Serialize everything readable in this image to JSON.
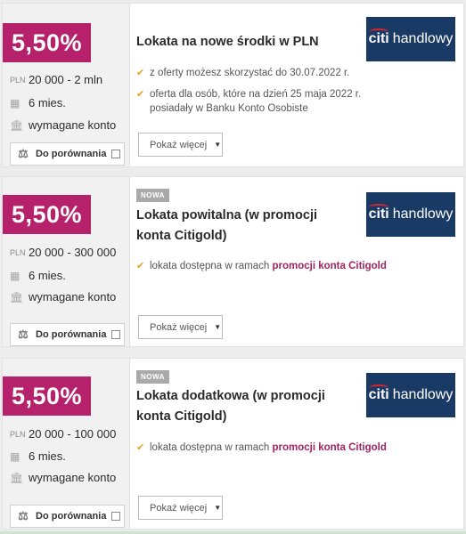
{
  "offers": [
    {
      "rate": "5,50%",
      "currency_label": "PLN",
      "amount": "20 000 - 2 mln",
      "period": "6 mies.",
      "account": "wymagane konto",
      "compare_label": "Do porównania",
      "badge": "",
      "title": "Lokata na nowe środki w PLN",
      "bank_logo": {
        "brand": "citi",
        "text": "handlowy"
      },
      "features": [
        {
          "text": "z oferty możesz skorzystać do 30.07.2022 r.",
          "link": ""
        },
        {
          "text": "oferta dla osób, które na dzień 25 maja 2022 r. posiadały w Banku Konto Osobiste",
          "link": ""
        }
      ],
      "more_label": "Pokaż więcej"
    },
    {
      "rate": "5,50%",
      "currency_label": "PLN",
      "amount": "20 000 - 300 000",
      "period": "6 mies.",
      "account": "wymagane konto",
      "compare_label": "Do porównania",
      "badge": "NOWA",
      "title": "Lokata powitalna (w promocji konta Citigold)",
      "bank_logo": {
        "brand": "citi",
        "text": "handlowy"
      },
      "features": [
        {
          "text": "lokata dostępna w ramach ",
          "link": "promocji konta Citigold"
        }
      ],
      "more_label": "Pokaż więcej"
    },
    {
      "rate": "5,50%",
      "currency_label": "PLN",
      "amount": "20 000 - 100 000",
      "period": "6 mies.",
      "account": "wymagane konto",
      "compare_label": "Do porównania",
      "badge": "NOWA",
      "title": "Lokata dodatkowa (w promocji konta Citigold)",
      "bank_logo": {
        "brand": "citi",
        "text": "handlowy"
      },
      "features": [
        {
          "text": "lokata dostępna w ramach ",
          "link": "promocji konta Citigold"
        }
      ],
      "more_label": "Pokaż więcej"
    }
  ],
  "icons": {
    "calendar": "calendar-icon",
    "bank": "bank-icon",
    "scale": "scale-icon",
    "check": "check-icon",
    "caret": "caret-down-icon"
  },
  "colors": {
    "rate_bg": "#b5226b",
    "logo_bg": "#1a3a66",
    "check": "#e6a21e",
    "link": "#9e2560"
  }
}
